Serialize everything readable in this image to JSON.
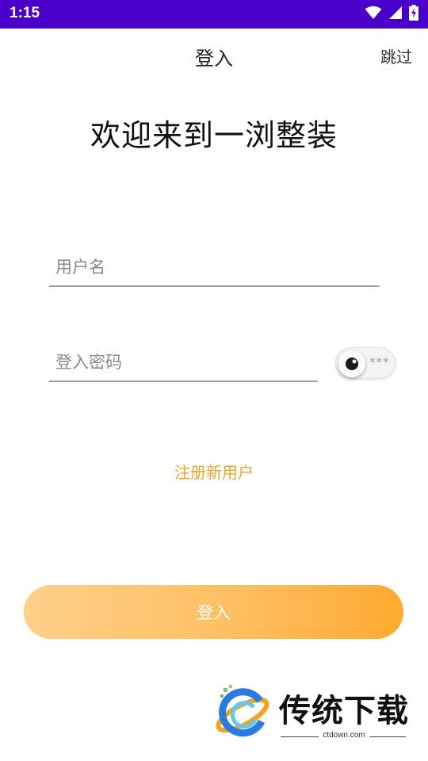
{
  "status_bar": {
    "time": "1:15",
    "icons": [
      "wifi-icon",
      "cellular-signal-icon",
      "battery-charging-icon"
    ]
  },
  "app_bar": {
    "title": "登入",
    "skip_label": "跳过"
  },
  "welcome_text": "欢迎来到一浏整装",
  "form": {
    "username": {
      "placeholder": "用户名",
      "value": ""
    },
    "password": {
      "placeholder": "登入密码",
      "value": ""
    },
    "password_toggle_mask": "***"
  },
  "register_label": "注册新用户",
  "login_button_label": "登入",
  "watermark": {
    "name": "传统下载",
    "url": "ctdown.com"
  },
  "colors": {
    "status_bar": "#4a00c8",
    "accent": "#f2a52c",
    "button_gradient_start": "#ffd08a",
    "button_gradient_end": "#ffaa30"
  }
}
